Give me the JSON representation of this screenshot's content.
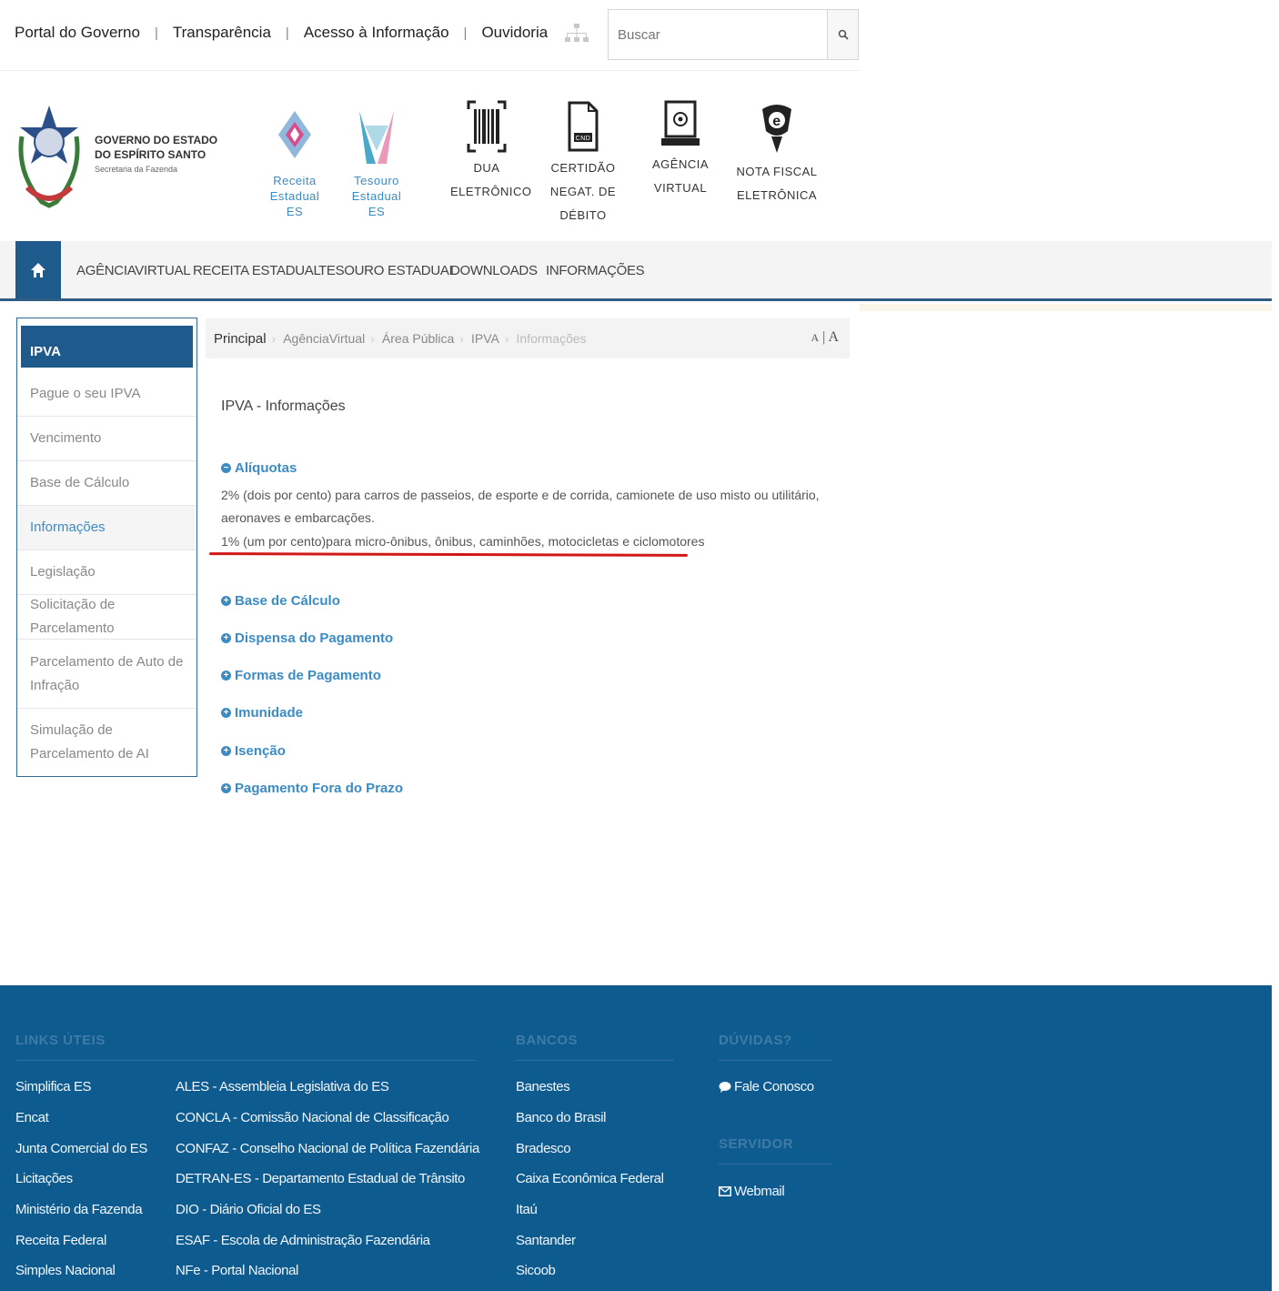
{
  "topbar": {
    "links": [
      "Portal do Governo",
      "Transparência",
      "Acesso à Informação",
      "Ouvidoria"
    ],
    "separator": "|",
    "search_placeholder": "Buscar"
  },
  "header": {
    "gov_line1": "GOVERNO DO ESTADO",
    "gov_line2": "DO ESPÍRITO SANTO",
    "gov_line3": "Secretaria da Fazenda",
    "receita": [
      "Receita",
      "Estadual ES"
    ],
    "tesouro": [
      "Tesouro",
      "Estadual ES"
    ],
    "dua": [
      "DUA",
      "ELETRÔNICO"
    ],
    "certidao": [
      "CERTIDÃO",
      "NEGAT. DE DÉBITO"
    ],
    "certidao_icon_text": "CND",
    "agencia": [
      "AGÊNCIA",
      "VIRTUAL"
    ],
    "nota": [
      "NOTA FISCAL",
      "ELETRÔNICA"
    ]
  },
  "nav": {
    "items": [
      "AGÊNCIAVIRTUAL",
      "RECEITA ESTADUAL",
      "TESOURO ESTADUAL",
      "DOWNLOADS",
      "INFORMAÇÕES"
    ]
  },
  "sidebar": {
    "title": "IPVA",
    "items": [
      "Pague o seu IPVA",
      "Vencimento",
      "Base de Cálculo",
      "Informações",
      "Legislação",
      "Solicitação de Parcelamento",
      "Parcelamento de Auto de Infração",
      "Simulação de Parcelamento de AI"
    ]
  },
  "breadcrumb": {
    "items": [
      "Principal",
      "AgênciaVirtual",
      "Área Pública",
      "IPVA",
      "Informações"
    ],
    "font_small": "A",
    "font_sep": "|",
    "font_large": "A"
  },
  "content": {
    "title": "IPVA - Informações",
    "sections": [
      "Alíquotas",
      "Base de Cálculo",
      "Dispensa do Pagamento",
      "Formas de Pagamento",
      "Imunidade",
      "Isenção",
      "Pagamento Fora do Prazo"
    ],
    "aliquota_p1": "2% (dois por cento) para carros de passeios, de esporte e de corrida, camionete de uso misto ou utilitário, aeronaves e embarcações.",
    "aliquota_p2": "1% (um por cento)para micro-ônibus, ônibus, caminhões, motocicletas e ciclomotores"
  },
  "footer": {
    "links_uteis_title": "LINKS ÚTEIS",
    "col1": [
      "Simplifica ES",
      "Encat",
      "Junta Comercial do ES",
      "Licitações",
      "Ministério da Fazenda",
      "Receita Federal",
      "Simples Nacional"
    ],
    "col2": [
      "ALES - Assembleia Legislativa do ES",
      "CONCLA - Comissão Nacional de Classificação",
      "CONFAZ - Conselho Nacional de Política Fazendária",
      "DETRAN-ES - Departamento Estadual de Trânsito",
      "DIO - Diário Oficial do ES",
      "ESAF - Escola de Administração Fazendária",
      "NFe - Portal Nacional"
    ],
    "bancos_title": "BANCOS",
    "bancos": [
      "Banestes",
      "Banco do Brasil",
      "Bradesco",
      "Caixa Econômica Federal",
      "Itaú",
      "Santander",
      "Sicoob"
    ],
    "duvidas_title": "DÚVIDAS?",
    "fale_conosco": "Fale Conosco",
    "servidor_title": "SERVIDOR",
    "webmail": "Webmail"
  }
}
